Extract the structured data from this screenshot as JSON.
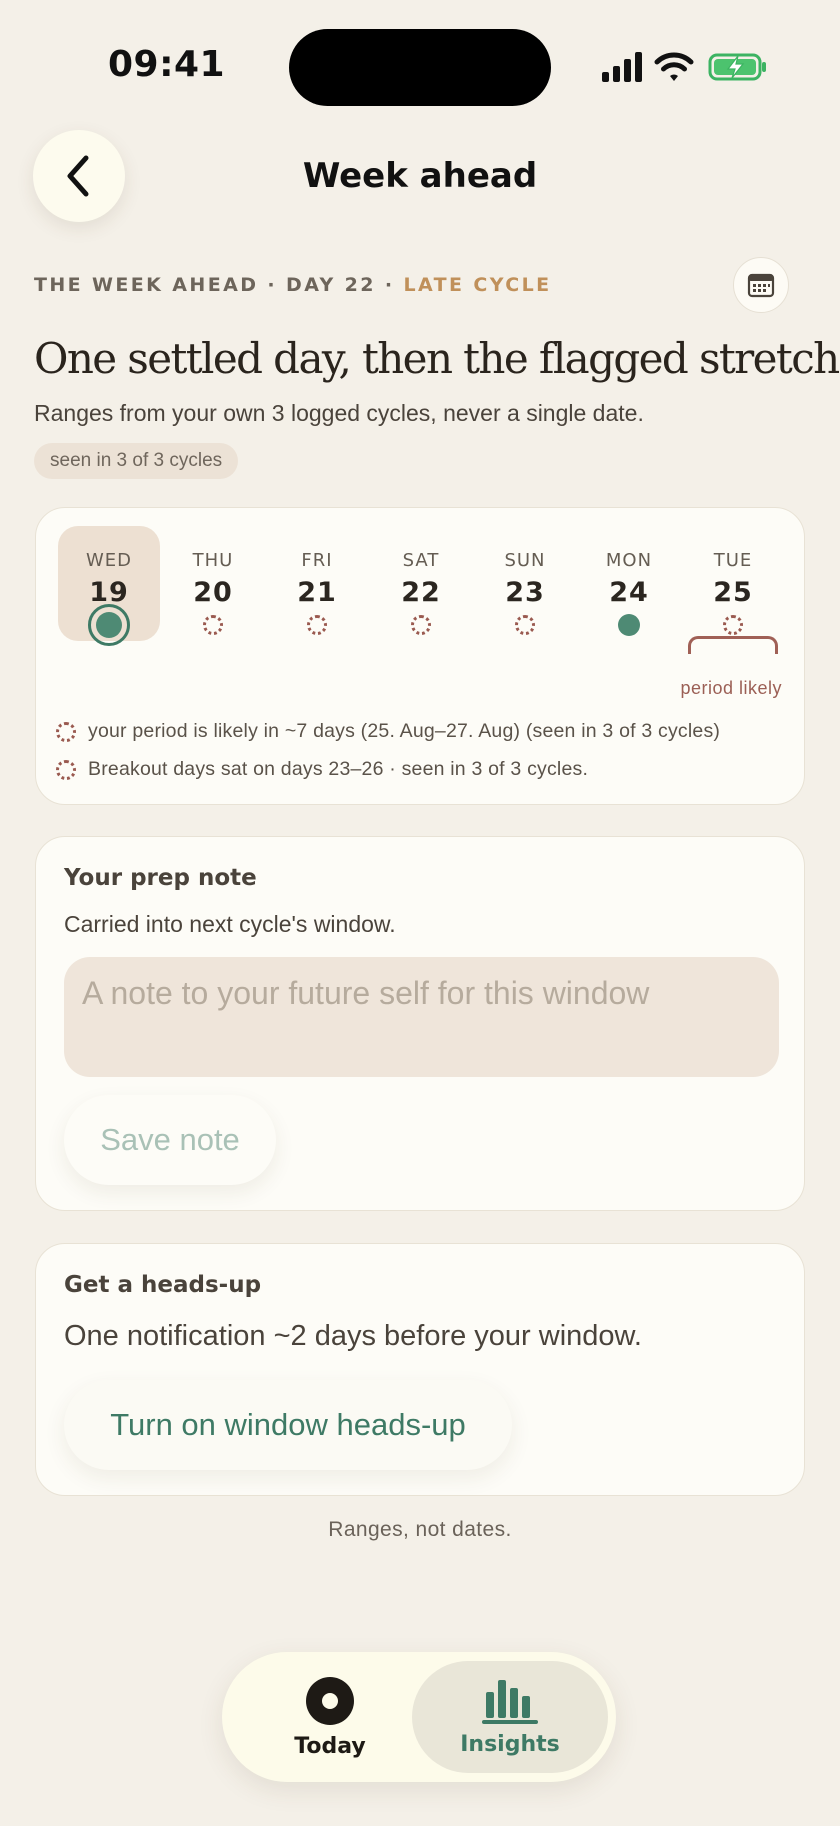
{
  "status_bar": {
    "time": "09:41"
  },
  "header": {
    "title": "Week ahead",
    "back_icon": "chevron-left-icon"
  },
  "context": {
    "eyebrow_main": "THE WEEK AHEAD · DAY 22 ·",
    "eyebrow_phase": "LATE CYCLE",
    "calendar_icon": "calendar-icon",
    "headline": "One settled day, then the flagged stretch",
    "subline": "Ranges from your own 3 logged cycles, never a single date.",
    "confidence_pill": "seen in 3 of 3 cycles"
  },
  "week": {
    "days": [
      {
        "name": "WED",
        "num": "19",
        "marker": "today"
      },
      {
        "name": "THU",
        "num": "20",
        "marker": "dashed"
      },
      {
        "name": "FRI",
        "num": "21",
        "marker": "dashed"
      },
      {
        "name": "SAT",
        "num": "22",
        "marker": "dashed"
      },
      {
        "name": "SUN",
        "num": "23",
        "marker": "dashed"
      },
      {
        "name": "MON",
        "num": "24",
        "marker": "solid"
      },
      {
        "name": "TUE",
        "num": "25",
        "marker": "dashed"
      }
    ],
    "period_label": "period likely",
    "legend": [
      "your period is likely in ~7 days (25. Aug–27. Aug) (seen in 3 of 3 cycles)",
      "Breakout days sat on days 23–26 · seen in 3 of 3 cycles."
    ]
  },
  "prep_note": {
    "title": "Your prep note",
    "description": "Carried into next cycle's window.",
    "placeholder": "A note to your future self for this window",
    "value": "",
    "save_label": "Save note"
  },
  "heads_up": {
    "title": "Get a heads-up",
    "description": "One notification ~2 days before your window.",
    "button_label": "Turn on window heads-up"
  },
  "footer_note": "Ranges, not dates.",
  "tabs": [
    {
      "label": "Today",
      "icon": "today-icon",
      "active": false
    },
    {
      "label": "Insights",
      "icon": "bar-chart-icon",
      "active": true
    }
  ],
  "colors": {
    "background": "#f4f0e8",
    "accent_green": "#3e7a65",
    "accent_gold": "#c0905a",
    "period_red": "#9a5a50"
  }
}
